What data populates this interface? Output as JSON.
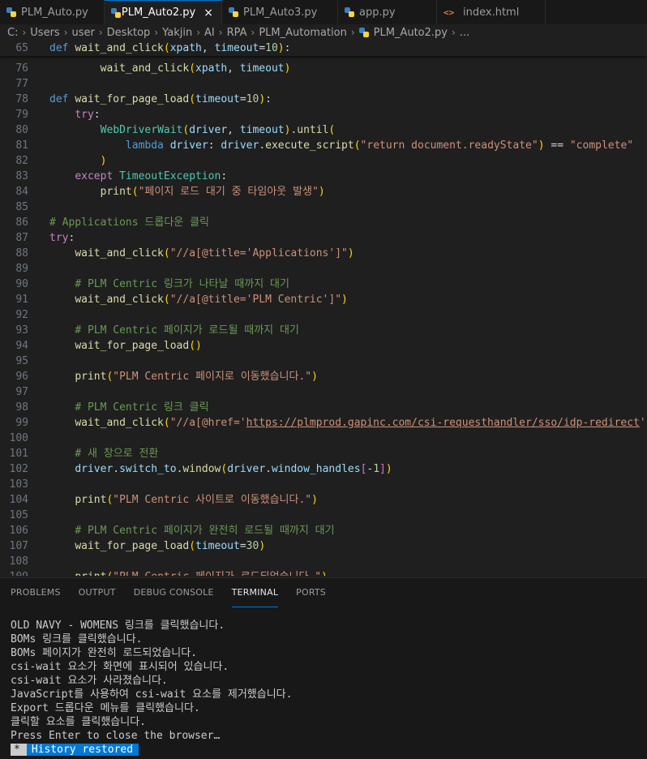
{
  "tabs": [
    {
      "label": "PLM_Auto.py",
      "icon": "python-icon",
      "active": false
    },
    {
      "label": "PLM_Auto2.py",
      "icon": "python-icon",
      "active": true,
      "close": "×"
    },
    {
      "label": "PLM_Auto3.py",
      "icon": "python-icon",
      "active": false
    },
    {
      "label": "app.py",
      "icon": "python-icon",
      "active": false
    },
    {
      "label": "index.html",
      "icon": "html-icon",
      "active": false
    }
  ],
  "breadcrumb": {
    "items": [
      "C:",
      "Users",
      "user",
      "Desktop",
      "Yakjin",
      "AI",
      "RPA",
      "PLM_Automation",
      "PLM_Auto2.py",
      "..."
    ],
    "separator": "›"
  },
  "editor": {
    "sticky_line": {
      "number": "65",
      "text": "def wait_and_click(xpath, timeout=10):"
    },
    "lines": [
      {
        "number": "76",
        "text": "        wait_and_click(xpath, timeout)"
      },
      {
        "number": "77",
        "text": ""
      },
      {
        "number": "78",
        "text": "def wait_for_page_load(timeout=10):"
      },
      {
        "number": "79",
        "text": "    try:"
      },
      {
        "number": "80",
        "text": "        WebDriverWait(driver, timeout).until("
      },
      {
        "number": "81",
        "text": "            lambda driver: driver.execute_script(\"return document.readyState\") == \"complete\""
      },
      {
        "number": "82",
        "text": "        )"
      },
      {
        "number": "83",
        "text": "    except TimeoutException:"
      },
      {
        "number": "84",
        "text": "        print(\"페이지 로드 대기 중 타임아웃 발생\")"
      },
      {
        "number": "85",
        "text": ""
      },
      {
        "number": "86",
        "text": "# Applications 드롭다운 클릭"
      },
      {
        "number": "87",
        "text": "try:"
      },
      {
        "number": "88",
        "text": "    wait_and_click(\"//a[@title='Applications']\")"
      },
      {
        "number": "89",
        "text": ""
      },
      {
        "number": "90",
        "text": "    # PLM Centric 링크가 나타날 때까지 대기"
      },
      {
        "number": "91",
        "text": "    wait_and_click(\"//a[@title='PLM Centric']\")"
      },
      {
        "number": "92",
        "text": ""
      },
      {
        "number": "93",
        "text": "    # PLM Centric 페이지가 로드될 때까지 대기"
      },
      {
        "number": "94",
        "text": "    wait_for_page_load()"
      },
      {
        "number": "95",
        "text": ""
      },
      {
        "number": "96",
        "text": "    print(\"PLM Centric 페이지로 이동했습니다.\")"
      },
      {
        "number": "97",
        "text": ""
      },
      {
        "number": "98",
        "text": "    # PLM Centric 링크 클릭"
      },
      {
        "number": "99",
        "text": "    wait_and_click(\"//a[@href='https://plmprod.gapinc.com/csi-requesthandler/sso/idp-redirect']\")"
      },
      {
        "number": "100",
        "text": ""
      },
      {
        "number": "101",
        "text": "    # 새 창으로 전환"
      },
      {
        "number": "102",
        "text": "    driver.switch_to.window(driver.window_handles[-1])"
      },
      {
        "number": "103",
        "text": ""
      },
      {
        "number": "104",
        "text": "    print(\"PLM Centric 사이트로 이동했습니다.\")"
      },
      {
        "number": "105",
        "text": ""
      },
      {
        "number": "106",
        "text": "    # PLM Centric 페이지가 완전히 로드될 때까지 대기"
      },
      {
        "number": "107",
        "text": "    wait_for_page_load(timeout=30)"
      },
      {
        "number": "108",
        "text": ""
      },
      {
        "number": "109",
        "text": "    print(\"PLM Centric 페이지가 로드되었습니다.\")"
      }
    ]
  },
  "panel": {
    "tabs": [
      {
        "label": "PROBLEMS",
        "active": false
      },
      {
        "label": "OUTPUT",
        "active": false
      },
      {
        "label": "DEBUG CONSOLE",
        "active": false
      },
      {
        "label": "TERMINAL",
        "active": true
      },
      {
        "label": "PORTS",
        "active": false
      }
    ],
    "terminal_lines": [
      "OLD NAVY - WOMENS 링크를 클릭했습니다.",
      "BOMs 링크를 클릭했습니다.",
      "BOMs 페이지가 완전히 로드되었습니다.",
      "csi-wait 요소가 화면에 표시되어 있습니다.",
      "csi-wait 요소가 사라졌습니다.",
      "JavaScript를 사용하여 csi-wait 요소를 제거했습니다.",
      "Export 드롭다운 메뉴를 클릭했습니다.",
      "클릭할 요소를 클릭했습니다.",
      "Press Enter to close the browser…"
    ],
    "history_badge": {
      "star": "*",
      "text": "History restored"
    }
  },
  "colors": {
    "background": "#1f1f1f",
    "accent": "#0078d4",
    "keyword": "#569cd6",
    "control": "#c586c0",
    "function": "#dcdcaa",
    "variable": "#9cdcfe",
    "string": "#ce9178",
    "number": "#b5cea8",
    "comment": "#6a9955",
    "class": "#4ec9b0"
  }
}
